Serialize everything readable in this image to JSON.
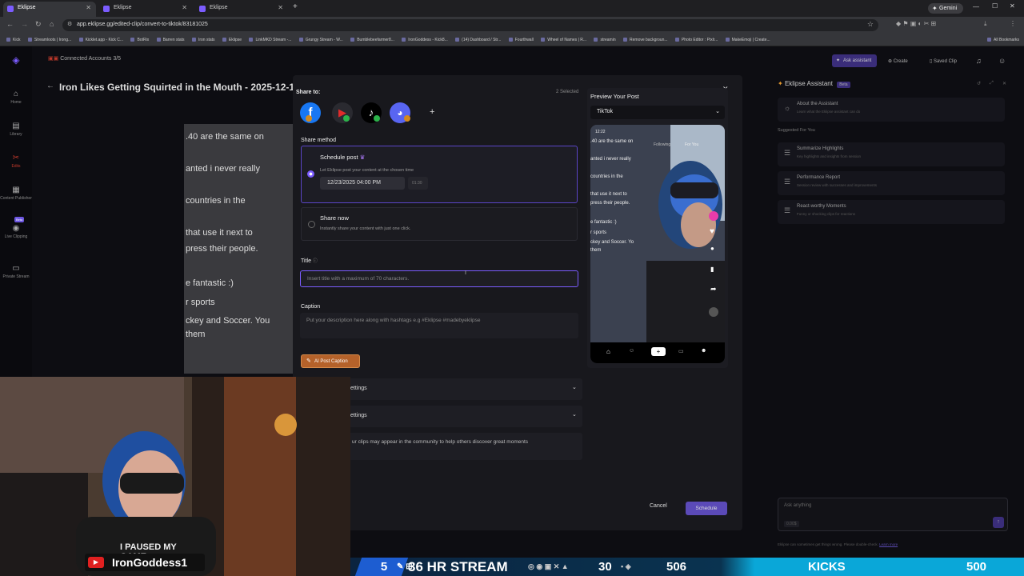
{
  "browser": {
    "tabs": [
      {
        "label": "Eklipse"
      },
      {
        "label": "Eklipse"
      },
      {
        "label": "Eklipse"
      }
    ],
    "new_tab": "+",
    "url": "app.eklipse.gg/edited-clip/convert-to-tiktok/83181025",
    "profile": "Gemini",
    "bookmarks": [
      "Kick",
      "Streamloots | Irong...",
      "Kicklet.app - Kick C...",
      "BotRix",
      "Barren stats",
      "Iron stats",
      "Eklipse",
      "LinkMKD Stream -...",
      "Grungy Stream - W...",
      "Bumblebeefarmer8...",
      "IronGoddess - Kick8...",
      "(14) Dashboard / Str...",
      "Fourthwall",
      "Wheel of Names | R...",
      "streamin",
      "Remove backgroun...",
      "Photo Editor : Pixlr...",
      "MakeEmoji | Create..."
    ],
    "all_bookmarks": "All Bookmarks"
  },
  "app": {
    "connected": "Connected Accounts 3/5",
    "ask_assistant": "Ask assistant",
    "create": "Create",
    "saved_clip": "Saved Clip",
    "clip_title": "Iron Likes Getting Squirted in the Mouth - 2025-12-1",
    "nav": [
      {
        "label": "Home"
      },
      {
        "label": "Library"
      },
      {
        "label": "Edits"
      },
      {
        "label": "Content Publisher"
      },
      {
        "label": "Live Clipping"
      },
      {
        "label": "Private Stream"
      }
    ],
    "beta": "Beta",
    "captions": [
      ".40 are the same on",
      "anted i never really",
      "countries in the",
      "that use it next to",
      "press their people.",
      "e fantastic :)",
      "r sports",
      "ckey and Soccer. You",
      "them"
    ]
  },
  "assistant": {
    "title": "Eklipse Assistant",
    "beta": "Beta",
    "about_title": "About the Assistant",
    "about_desc": "Learn what the Eklipse assistant can do",
    "suggested": "Suggested For You",
    "items": [
      {
        "title": "Summarize Highlights",
        "desc": "Key highlights and insights from session"
      },
      {
        "title": "Performance Report",
        "desc": "Session review with successes and improvements"
      },
      {
        "title": "React-worthy Moments",
        "desc": "Funny or shocking clips for reactions"
      }
    ],
    "input_placeholder": "Ask anything",
    "credit": "0.00$",
    "disclaimer": "Eklipse can sometimes get things wrong. Please double-check.",
    "learn_more": "Learn more"
  },
  "modal": {
    "share_to": "Share to:",
    "selected": "2 Selected",
    "add": "+",
    "share_method": "Share method",
    "schedule_title": "Schedule post",
    "schedule_desc": "Let Eklipse post your content at the chosen time",
    "date_value": "12/23/2025 04:00 PM",
    "duration": "01:30",
    "sharenow_title": "Share now",
    "sharenow_desc": "Instantly share your content with just one click.",
    "title_label": "Title",
    "title_placeholder": "Insert title with a maximum of 70 characters.",
    "caption_label": "Caption",
    "caption_placeholder": "Put your description here along with hashtags e.g #Eklipse #madebyeklipse",
    "ai_button": "AI Post Caption",
    "settings1": "ettings",
    "settings2": "ettings",
    "community": "ur clips may appear in the community to help others discover great moments",
    "cancel": "Cancel",
    "schedule": "Schedule",
    "close": "✕"
  },
  "preview": {
    "title": "Preview Your Post",
    "platform": "TikTok",
    "time": "12:22",
    "tab_following": "Following",
    "tab_foryou": "For You",
    "lines": [
      ".40 are the same on",
      "anted i never really",
      "countries in the",
      "that use it next to",
      "press their people.",
      "e fantastic :)",
      "r sports",
      "ckey and Soccer. Yo",
      "them"
    ]
  },
  "stream": {
    "username": "IronGoddess1",
    "shirt_text": "I PAUSED MY GAME",
    "ticker_num1": "5",
    "ticker_text": "36 HR STREAM",
    "ticker_num2": "30",
    "ticker_num3": "506",
    "ticker_kicks": "KICKS",
    "ticker_num4": "500"
  },
  "colors": {
    "accent": "#6c56e0",
    "schedule_btn": "#5b4ab8",
    "ai_btn": "#b5622a",
    "bottom_bar": "#0aa7d8"
  }
}
